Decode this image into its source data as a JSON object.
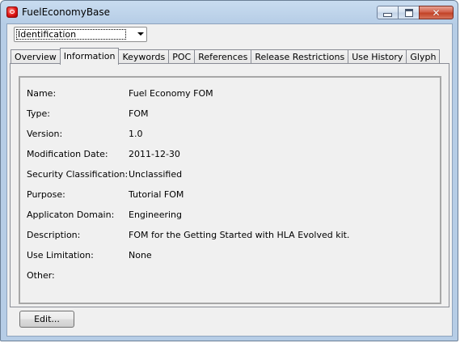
{
  "window": {
    "title": "FuelEconomyBase"
  },
  "combo": {
    "selected": "Identification"
  },
  "tabs": [
    {
      "label": "Overview"
    },
    {
      "label": "Information"
    },
    {
      "label": "Keywords"
    },
    {
      "label": "POC"
    },
    {
      "label": "References"
    },
    {
      "label": "Release Restrictions"
    },
    {
      "label": "Use History"
    },
    {
      "label": "Glyph"
    }
  ],
  "active_tab": "Information",
  "fields": [
    {
      "label": "Name:",
      "value": "Fuel Economy FOM"
    },
    {
      "label": "Type:",
      "value": "FOM"
    },
    {
      "label": "Version:",
      "value": "1.0"
    },
    {
      "label": "Modification Date:",
      "value": "2011-12-30"
    },
    {
      "label": "Security Classification:",
      "value": "Unclassified"
    },
    {
      "label": "Purpose:",
      "value": "Tutorial FOM"
    },
    {
      "label": "Applicaton Domain:",
      "value": "Engineering"
    },
    {
      "label": "Description:",
      "value": "FOM for the Getting Started with HLA Evolved kit."
    },
    {
      "label": "Use Limitation:",
      "value": "None"
    },
    {
      "label": "Other:",
      "value": ""
    }
  ],
  "edit_button": {
    "label": "Edit..."
  }
}
